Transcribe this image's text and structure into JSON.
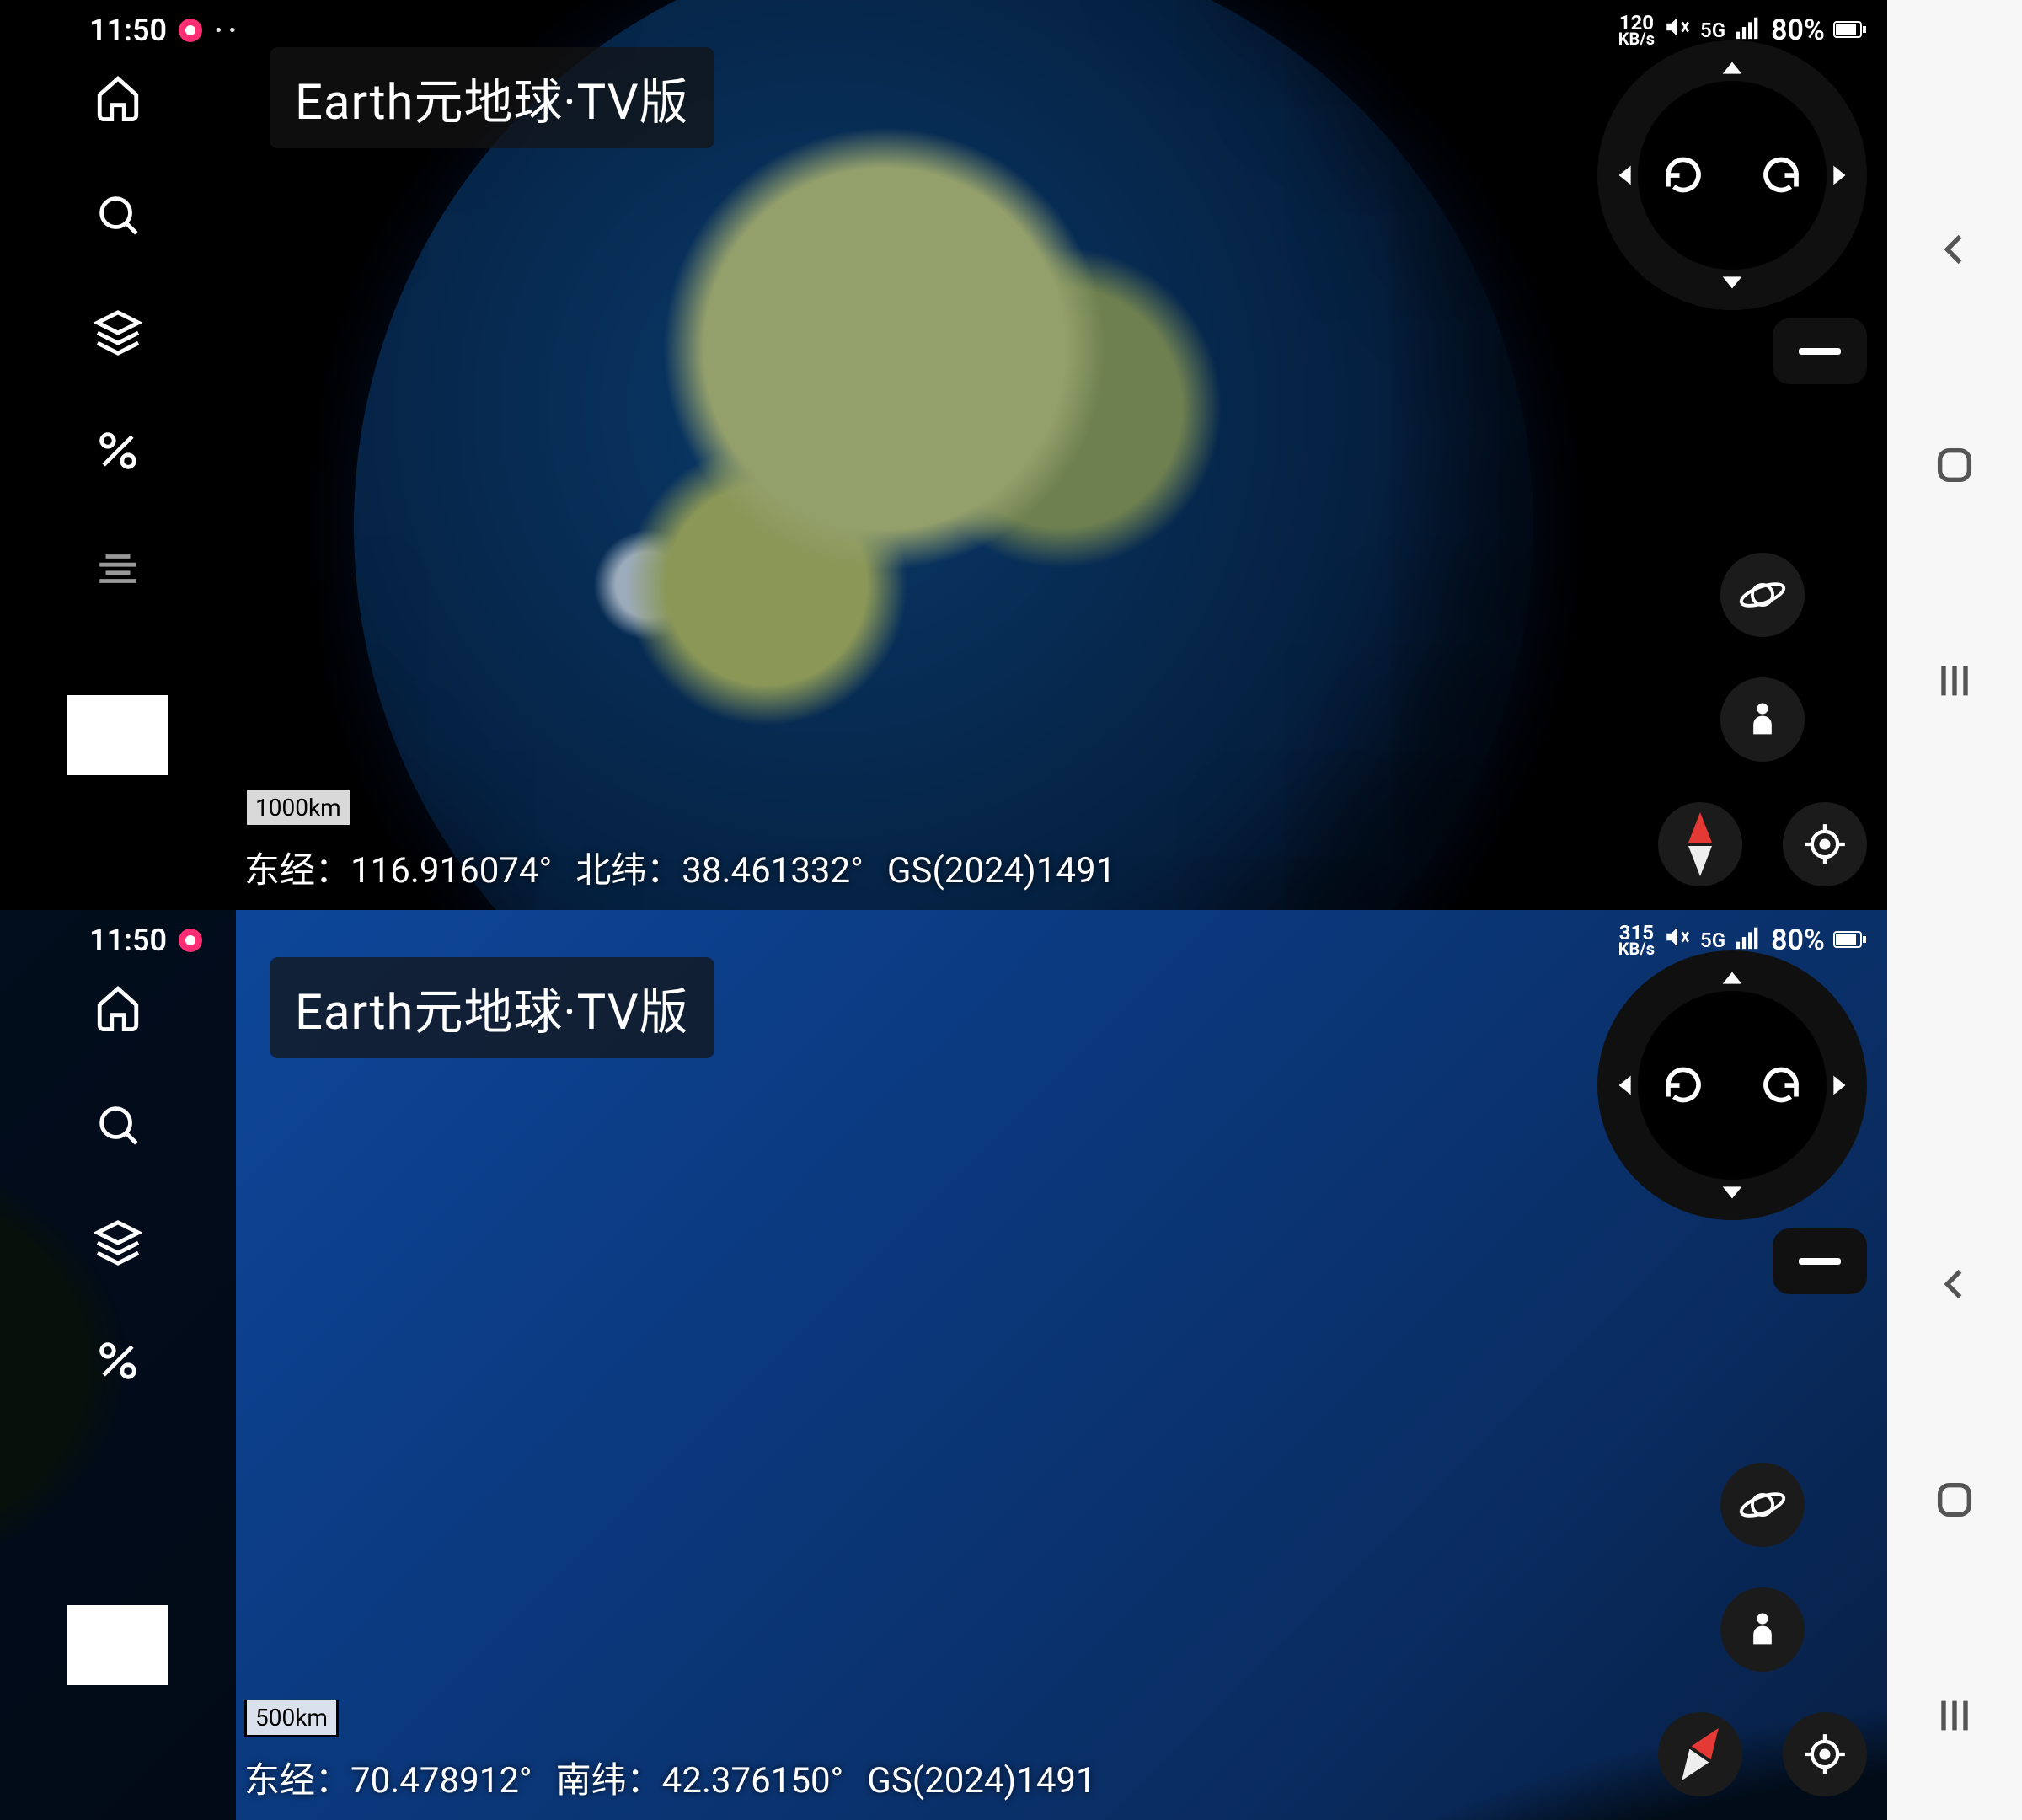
{
  "system_nav": {
    "back_icon": "back-icon",
    "home_icon": "home-icon",
    "recents_icon": "recents-icon"
  },
  "panels": [
    {
      "status": {
        "time": "11:50",
        "net_speed_value": "120",
        "net_speed_unit": "KB/s",
        "network_label": "5G",
        "battery_percent": "80%"
      },
      "title": "Earth元地球·TV版",
      "scale_label": "1000km",
      "readout": {
        "lon_label": "东经：",
        "lon_value": "116.916074°",
        "lat_label": "北纬：",
        "lat_value": "38.461332°",
        "gs_code": "GS(2024)1491"
      }
    },
    {
      "status": {
        "time": "11:50",
        "net_speed_value": "315",
        "net_speed_unit": "KB/s",
        "network_label": "5G",
        "battery_percent": "80%"
      },
      "title": "Earth元地球·TV版",
      "scale_label": "500km",
      "readout": {
        "lon_label": "东经：",
        "lon_value": "70.478912°",
        "lat_label": "南纬：",
        "lat_value": "42.376150°",
        "gs_code": "GS(2024)1491"
      }
    }
  ]
}
